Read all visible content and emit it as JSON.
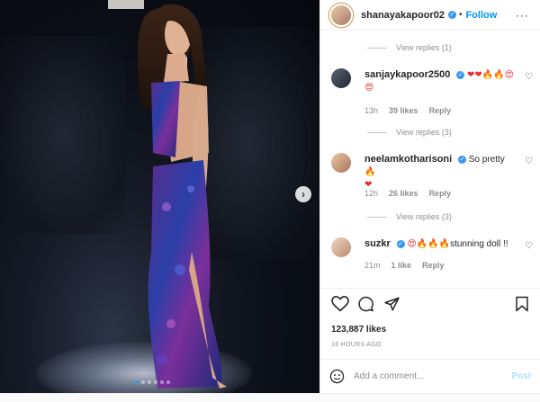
{
  "post": {
    "author": "shanayakapoor02",
    "follow_label": "Follow",
    "more_label": "···",
    "likes": "123,887 likes",
    "timestamp": "16 HOURS AGO",
    "carousel": {
      "count": 6,
      "active": 0
    },
    "next_glyph": "›"
  },
  "comments": [
    {
      "type": "replies",
      "label": "View replies (1)"
    },
    {
      "type": "comment",
      "user": "sanjaykapoor2500",
      "verified": true,
      "text": "",
      "emojis": "❤❤🔥🔥😍",
      "emojis2": "😍",
      "time": "13h",
      "likes": "39 likes",
      "reply": "Reply"
    },
    {
      "type": "replies",
      "label": "View replies (3)"
    },
    {
      "type": "comment",
      "user": "neelamkotharisoni",
      "verified": true,
      "text": "So pretty",
      "emojis": "🔥",
      "emojis2": "❤",
      "time": "12h",
      "likes": "26 likes",
      "reply": "Reply"
    },
    {
      "type": "replies",
      "label": "View replies (3)"
    },
    {
      "type": "comment",
      "user": "suzkr",
      "verified": true,
      "text": "stunning doll !!",
      "emojis": "😍🔥🔥🔥",
      "time": "21m",
      "likes": "1 like",
      "reply": "Reply"
    }
  ],
  "compose": {
    "placeholder": "Add a comment...",
    "post_label": "Post"
  },
  "icons": [
    "heart-icon",
    "comment-icon",
    "share-icon",
    "bookmark-icon",
    "emoji-icon"
  ],
  "colors": {
    "accent": "#0095f6",
    "verified": "#3897f0",
    "muted": "#8e8e8e"
  }
}
